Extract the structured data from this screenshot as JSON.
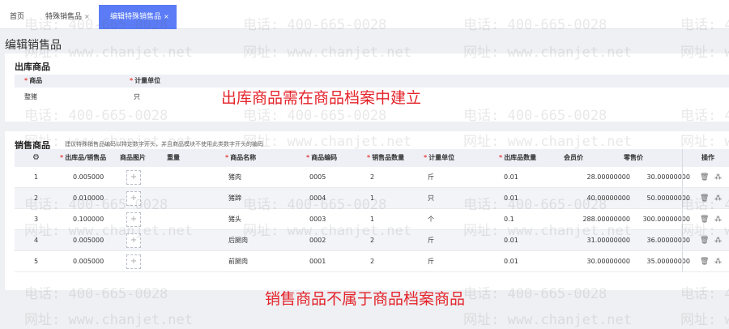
{
  "tabs": [
    {
      "label": "首页"
    },
    {
      "label": "特殊销售品",
      "close": "×"
    },
    {
      "label": "编辑特殊销售品",
      "close": "×"
    }
  ],
  "page_title": "编辑销售品",
  "outbound": {
    "title": "出库商品",
    "headers": [
      "商品",
      "计量单位"
    ],
    "row": {
      "product": "整猪",
      "unit": "只"
    }
  },
  "sales": {
    "title": "销售商品",
    "hint": "建议特殊销售品编码以特定数字开头，并且商品模块不使用此类数字开头的编码",
    "headers": {
      "ratio": "出库品/销售品",
      "image": "商品图片",
      "weight": "重量",
      "name": "商品名称",
      "code": "商品编码",
      "qty": "销售品数量",
      "unit": "计量单位",
      "out_qty": "出库品数量",
      "member_price": "会员价",
      "retail_price": "零售价",
      "ops": "操作"
    },
    "image_placeholder": "+",
    "rows": [
      {
        "no": "1",
        "ratio": "0.005000",
        "name": "猪肉",
        "code": "0005",
        "qty": "2",
        "unit": "斤",
        "out_qty": "0.01",
        "member_price": "28.00000000",
        "retail_price": "30.00000000"
      },
      {
        "no": "2",
        "ratio": "0.010000",
        "name": "猪蹄",
        "code": "0004",
        "qty": "1",
        "unit": "只",
        "out_qty": "0.01",
        "member_price": "40.00000000",
        "retail_price": "50.00000000"
      },
      {
        "no": "3",
        "ratio": "0.100000",
        "name": "猪头",
        "code": "0003",
        "qty": "1",
        "unit": "个",
        "out_qty": "0.1",
        "member_price": "288.00000000",
        "retail_price": "300.00000000"
      },
      {
        "no": "4",
        "ratio": "0.005000",
        "name": "后腿肉",
        "code": "0002",
        "qty": "2",
        "unit": "斤",
        "out_qty": "0.01",
        "member_price": "31.00000000",
        "retail_price": "36.00000000"
      },
      {
        "no": "5",
        "ratio": "0.005000",
        "name": "前腿肉",
        "code": "0001",
        "qty": "2",
        "unit": "斤",
        "out_qty": "0.01",
        "member_price": "30.00000000",
        "retail_price": "35.00000000"
      }
    ]
  },
  "watermark": {
    "phone": "电话: 400-665-0028",
    "site": "网址: www.chanjet.net"
  },
  "annotations": {
    "outbound_note": "出库商品需在商品档案中建立",
    "sales_note": "销售商品不属于商品档案商品"
  },
  "colors": {
    "active_tab": "#5b7cf6",
    "required": "#e64340",
    "annotation": "#e4232a"
  }
}
